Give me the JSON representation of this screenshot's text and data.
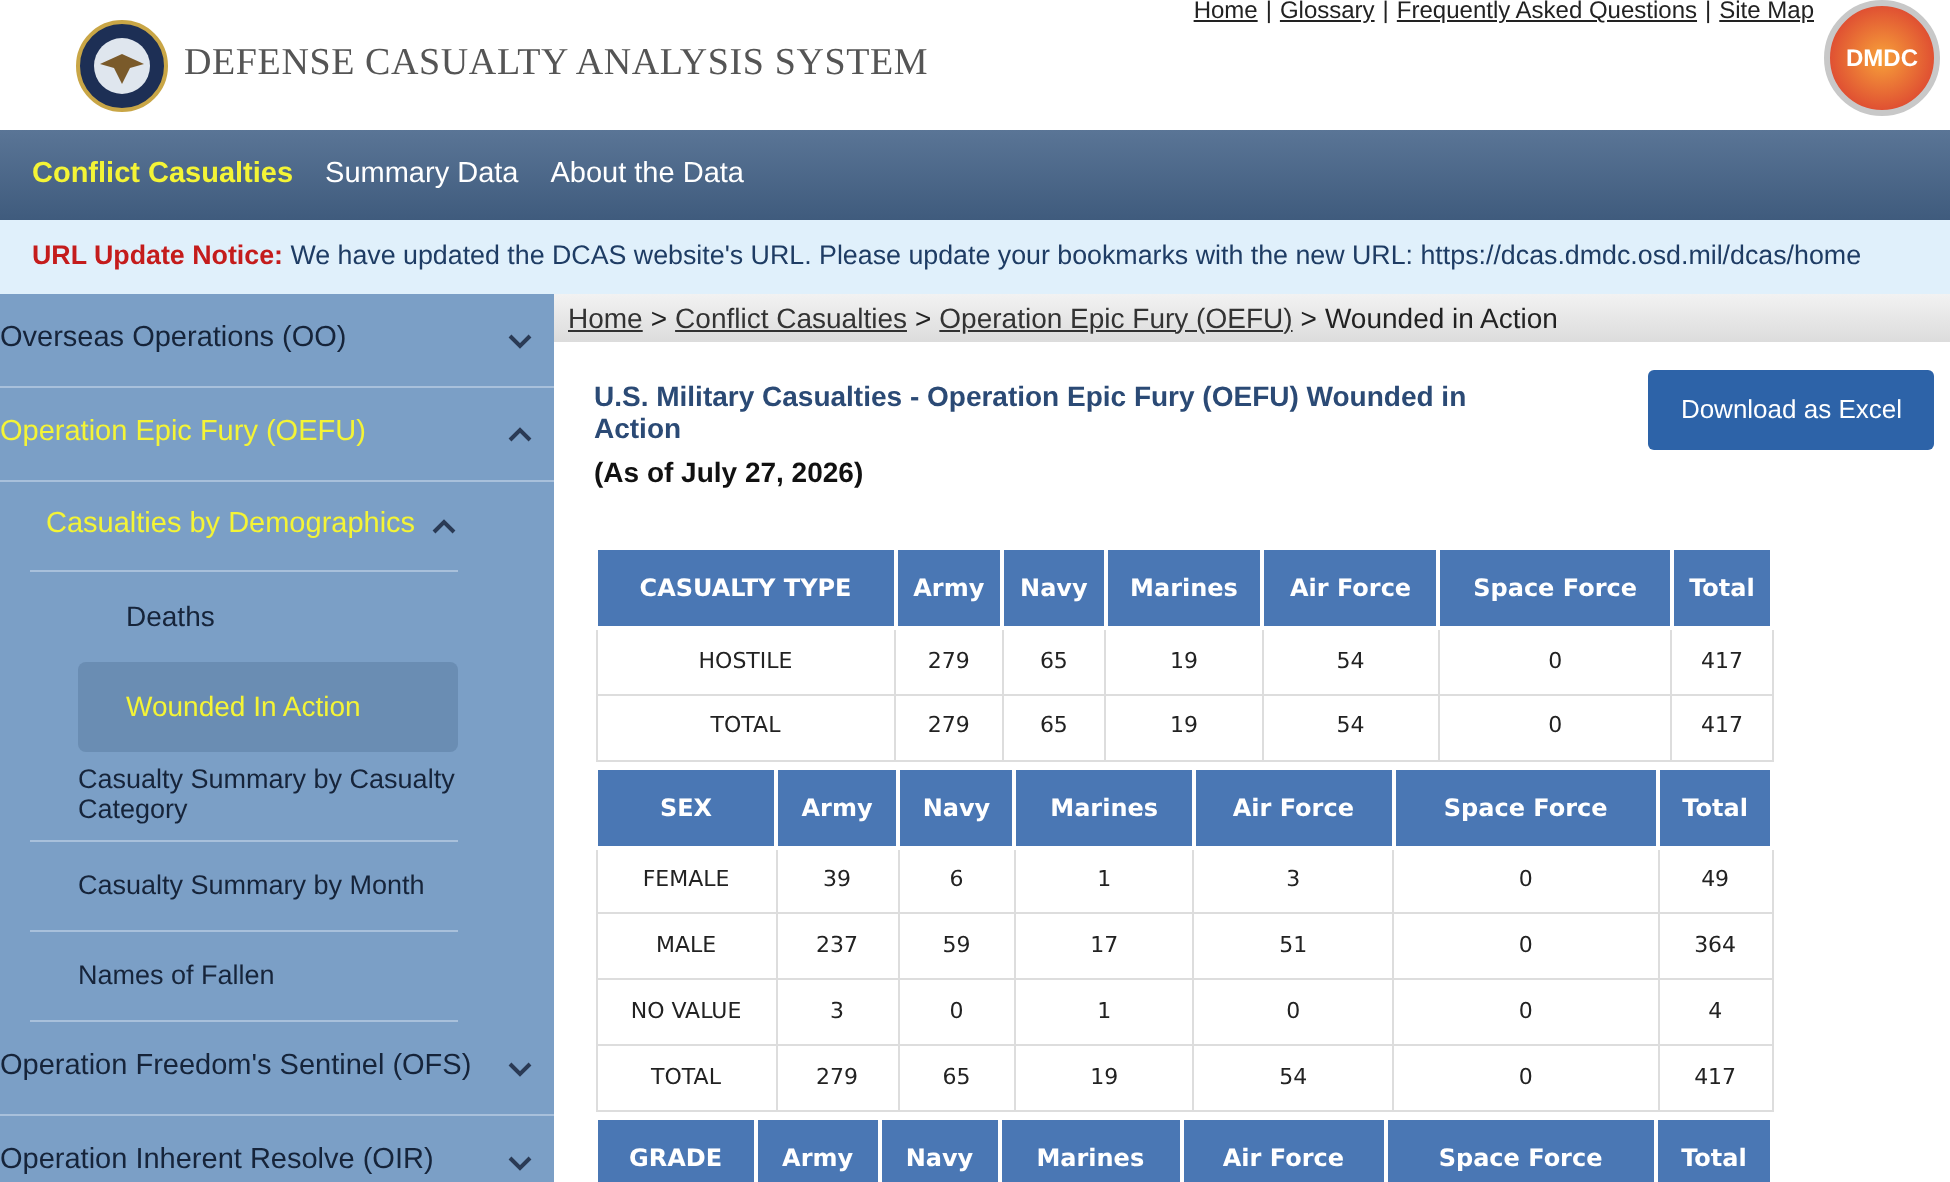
{
  "header": {
    "title": "DEFENSE CASUALTY ANALYSIS SYSTEM",
    "top_links": [
      {
        "kind": "link",
        "text": "Home"
      },
      {
        "kind": "separator",
        "text": "|"
      },
      {
        "kind": "link",
        "text": "Glossary"
      },
      {
        "kind": "separator",
        "text": "|"
      },
      {
        "kind": "link",
        "text": "Frequently Asked Questions"
      },
      {
        "kind": "separator",
        "text": "|"
      },
      {
        "kind": "link",
        "text": "Site Map"
      }
    ],
    "logo_text": "DMDC"
  },
  "nav": [
    {
      "label": "Conflict Casualties",
      "selected": true
    },
    {
      "label": "Summary Data",
      "selected": false
    },
    {
      "label": "About the Data",
      "selected": false
    }
  ],
  "notice": {
    "label": "URL Update Notice:",
    "text": "We have updated the DCAS website's URL. Please update your bookmarks with the new URL: https://dcas.dmdc.osd.mil/dcas/home"
  },
  "sidebar": {
    "items": [
      {
        "label": "Overseas Operations (OO)",
        "expanded": false
      },
      {
        "label": "Operation Epic Fury (OEFU)",
        "expanded": true,
        "children": [
          {
            "label": "Casualties by Demographics",
            "expanded": true,
            "children": [
              {
                "label": "Deaths",
                "selected": false
              },
              {
                "label": "Wounded In Action",
                "selected": true
              }
            ]
          },
          {
            "label": "Casualty Summary by Casualty Category",
            "selected": false
          },
          {
            "label": "Casualty Summary by Month",
            "selected": false
          },
          {
            "label": "Names of Fallen",
            "selected": false
          }
        ]
      },
      {
        "label": "Operation Freedom's Sentinel (OFS)",
        "expanded": false
      },
      {
        "label": "Operation Inherent Resolve (OIR)",
        "expanded": false
      }
    ]
  },
  "breadcrumb": [
    {
      "kind": "link",
      "text": "Home"
    },
    {
      "kind": "separator",
      "text": ">"
    },
    {
      "kind": "link",
      "text": "Conflict Casualties"
    },
    {
      "kind": "separator",
      "text": ">"
    },
    {
      "kind": "link",
      "text": "Operation Epic Fury (OEFU)"
    },
    {
      "kind": "separator",
      "text": ">"
    },
    {
      "kind": "current",
      "text": "Wounded in Action"
    }
  ],
  "page": {
    "title": "U.S. Military Casualties - Operation Epic Fury (OEFU) Wounded in Action",
    "as_of": "(As of July 27, 2026)",
    "download_button": "Download as Excel"
  },
  "tables": [
    {
      "columns": [
        "CASUALTY TYPE",
        "Army",
        "Navy",
        "Marines",
        "Air Force",
        "Space Force",
        "Total"
      ],
      "rows": [
        [
          "HOSTILE",
          "279",
          "65",
          "19",
          "54",
          "0",
          "417"
        ],
        [
          "TOTAL",
          "279",
          "65",
          "19",
          "54",
          "0",
          "417"
        ]
      ]
    },
    {
      "columns": [
        "SEX",
        "Army",
        "Navy",
        "Marines",
        "Air Force",
        "Space Force",
        "Total"
      ],
      "rows": [
        [
          "FEMALE",
          "39",
          "6",
          "1",
          "3",
          "0",
          "49"
        ],
        [
          "MALE",
          "237",
          "59",
          "17",
          "51",
          "0",
          "364"
        ],
        [
          "NO VALUE",
          "3",
          "0",
          "1",
          "0",
          "0",
          "4"
        ],
        [
          "TOTAL",
          "279",
          "65",
          "19",
          "54",
          "0",
          "417"
        ]
      ]
    },
    {
      "columns": [
        "GRADE",
        "Army",
        "Navy",
        "Marines",
        "Air Force",
        "Space Force",
        "Total"
      ]
    }
  ]
}
